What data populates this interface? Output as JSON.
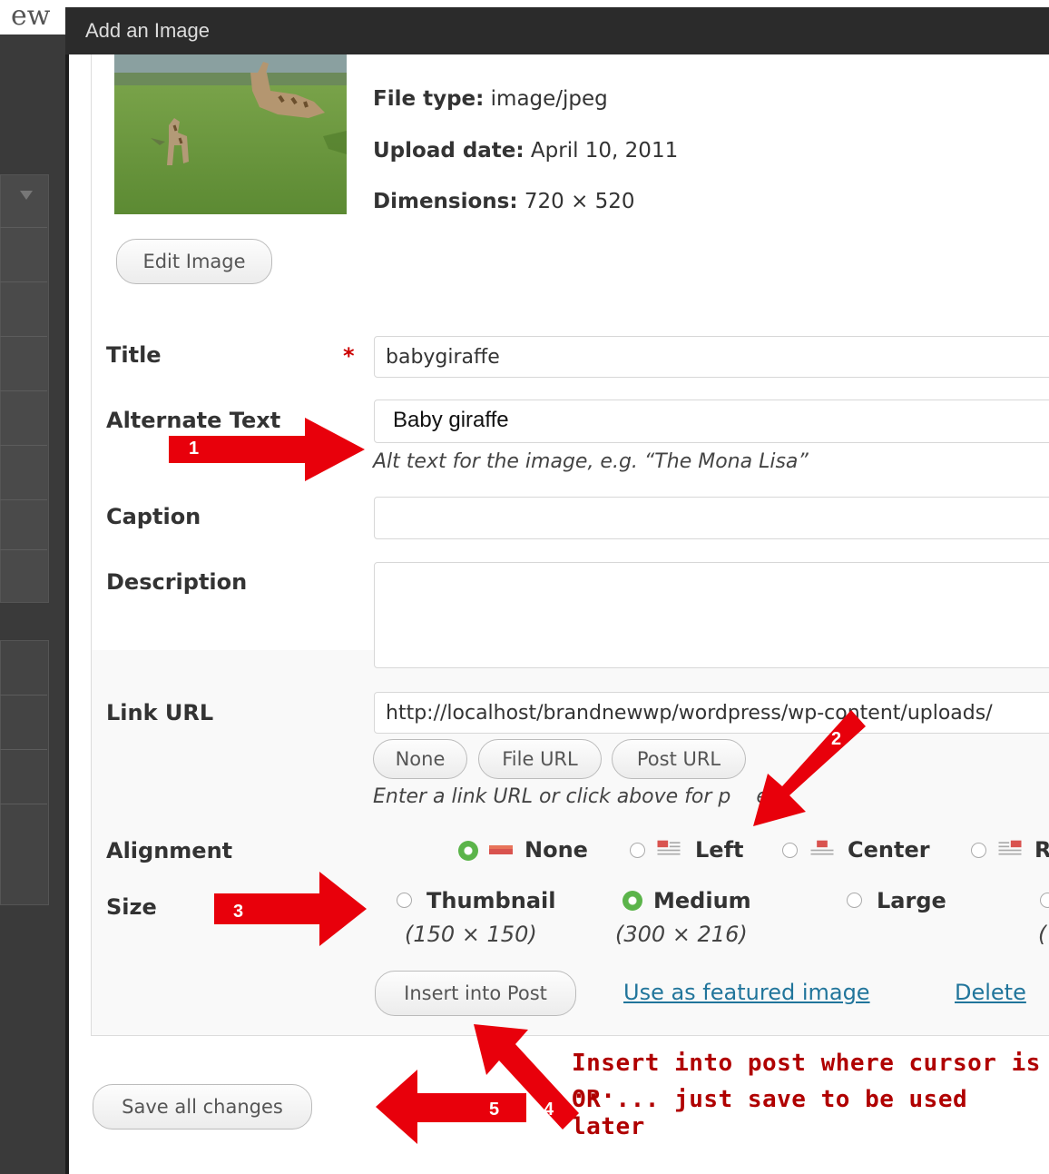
{
  "background": {
    "title_fragment": "ew"
  },
  "modal": {
    "title": "Add an Image"
  },
  "file_info": {
    "file_type_label": "File type:",
    "file_type": "image/jpeg",
    "upload_date_label": "Upload date:",
    "upload_date": "April 10, 2011",
    "dimensions_label": "Dimensions:",
    "dimensions": "720 × 520"
  },
  "edit_image_button": "Edit Image",
  "form": {
    "title_label": "Title",
    "required_mark": "*",
    "title_value": "babygiraffe",
    "alt_label": "Alternate Text",
    "alt_value": "Baby giraffe",
    "alt_help": "Alt text for the image, e.g. “The Mona Lisa”",
    "caption_label": "Caption",
    "caption_value": "",
    "description_label": "Description",
    "description_value": "",
    "link_label": "Link URL",
    "link_value": "http://localhost/brandnewwp/wordpress/wp-content/uploads/",
    "link_buttons": [
      "None",
      "File URL",
      "Post URL"
    ],
    "link_help_start": "Enter a link URL or click above for p",
    "link_help_end": "ets.",
    "alignment_label": "Alignment",
    "alignment_options": [
      "None",
      "Left",
      "Center",
      "R"
    ],
    "alignment_selected": "None",
    "size_label": "Size",
    "size_options": [
      {
        "label": "Thumbnail",
        "dims": "(150 × 150)"
      },
      {
        "label": "Medium",
        "dims": "(300 × 216)"
      },
      {
        "label": "Large",
        "dims": ""
      }
    ],
    "size_extra_dims": "(",
    "size_selected": "Medium"
  },
  "actions": {
    "insert_into_post": "Insert into Post",
    "use_as_featured": "Use as featured image",
    "delete": "Delete",
    "save_all": "Save all changes"
  },
  "annotations": {
    "arrow_numbers": [
      "1",
      "2",
      "3",
      "4",
      "5"
    ],
    "note_line1": "Insert into post where cursor is ...",
    "note_line2": "OR ... just save to be used later",
    "arrow_color": "#e8000b",
    "note_color": "#b00000"
  },
  "colors": {
    "header_bg": "#2b2b2b",
    "link": "#21759b",
    "radio_on": "#5bb44a"
  }
}
